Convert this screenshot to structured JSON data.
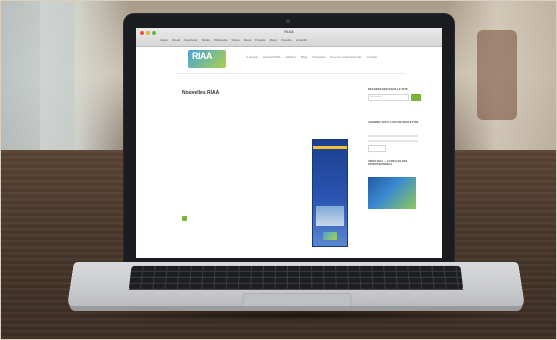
{
  "browser": {
    "tab_title": "RIAA",
    "bookmarks": [
      "Apple",
      "iCloud",
      "Facebook",
      "Twitter",
      "Wikipedia",
      "Yahoo",
      "News",
      "Popular",
      "Maps",
      "Youtube",
      "LinkedIn"
    ]
  },
  "site": {
    "logo_text": "RIAA",
    "nav": [
      "À propos",
      "Accueil RIAA",
      "Adhérer",
      "Blog",
      "Nouvelles",
      "Pour les professionnels",
      "Contact"
    ],
    "main_title": "Nouvelles RIAA",
    "subhead": "",
    "body_lines": [
      "",
      "",
      "",
      "",
      "",
      "",
      "",
      "",
      "",
      "",
      "",
      "",
      ""
    ],
    "cta_text": "",
    "poster_title": "",
    "sidebar": {
      "search_title": "RECHERCHER DANS LE SITE",
      "search_placeholder": "Rechercher",
      "newsletter_title": "ABONNEZ-VOUS À NOTRE INFOLETTRE",
      "video_title": "VIDÉO RIAA — CAPSULES DES PROFESSIONNELS"
    }
  }
}
